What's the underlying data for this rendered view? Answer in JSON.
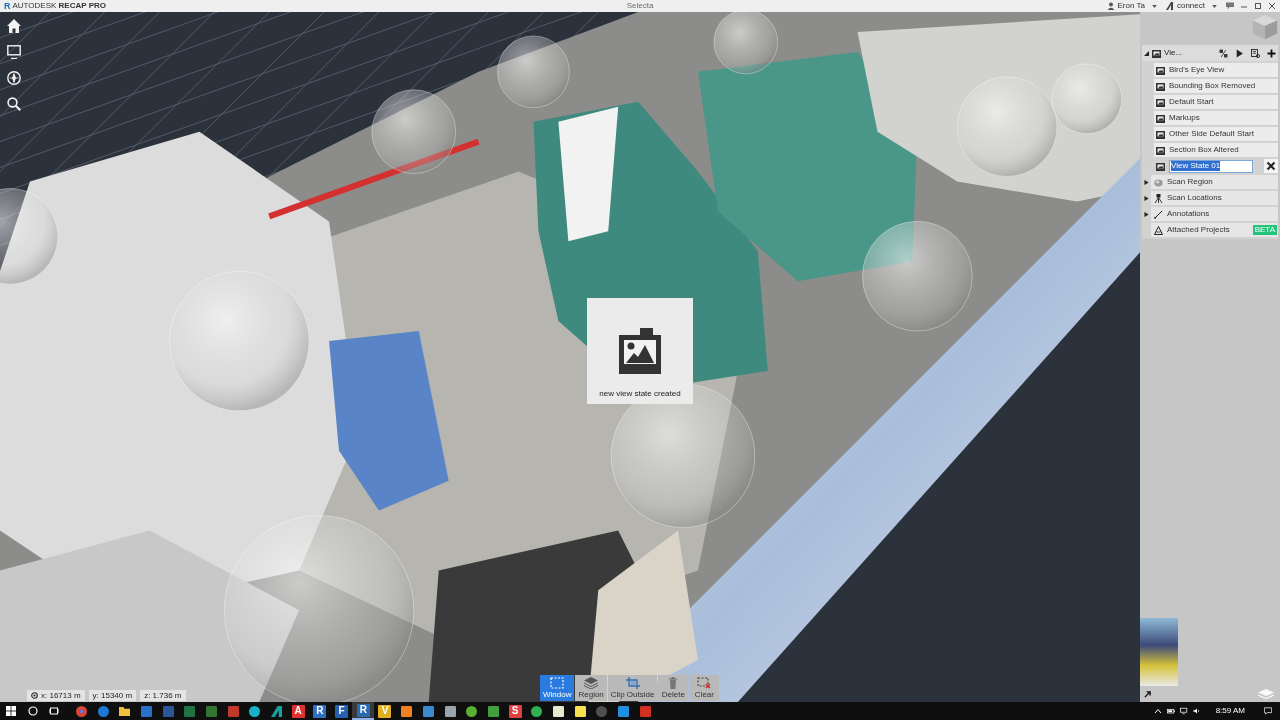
{
  "title_bar": {
    "logo": "R",
    "product": "AUTODESK **RECAP PRO**",
    "document": "Selecta",
    "user": "Eron Ta",
    "service": "connect"
  },
  "viewport": {
    "coordinates": [
      "x: 16713 m",
      "y: 15340 m",
      "z: 1.736 m"
    ]
  },
  "toast": {
    "message": "new view state created"
  },
  "selection_tools": [
    {
      "label": "Window",
      "kind": "window",
      "selected": true
    },
    {
      "label": "Region",
      "kind": "region",
      "selected": false
    },
    {
      "label": "Clip Outside",
      "kind": "clip",
      "selected": false
    },
    {
      "label": "Delete",
      "kind": "delete",
      "selected": false
    },
    {
      "label": "Clear",
      "kind": "clear",
      "selected": false
    }
  ],
  "navigator": {
    "title": "Vie...",
    "expanded": true,
    "view_states": [
      {
        "name": "Bird's Eye View",
        "selected": false
      },
      {
        "name": "Bounding Box Removed",
        "selected": false
      },
      {
        "name": "Default Start",
        "selected": false
      },
      {
        "name": "Markups",
        "selected": false
      },
      {
        "name": "Other Side Default Start",
        "selected": false
      },
      {
        "name": "Section Box Altered",
        "selected": false
      }
    ],
    "new_view_state": {
      "value": "View State 01",
      "text_selected": true
    },
    "sections": [
      {
        "label": "Scan Region",
        "kind": "regions",
        "expanded": false
      },
      {
        "label": "Scan Locations",
        "kind": "locations",
        "expanded": false
      },
      {
        "label": "Annotations",
        "kind": "annotations",
        "expanded": false
      }
    ],
    "attached_projects": {
      "label": "Attached Projects",
      "badge": "BETA"
    }
  },
  "taskbar": {
    "apps": [
      {
        "kind": "browser",
        "color": "#db4437",
        "active": false
      },
      {
        "kind": "round",
        "color": "#1e78d7",
        "active": false
      },
      {
        "kind": "folder",
        "color": "#f0c040",
        "active": false
      },
      {
        "kind": "tile",
        "color": "#2a6fc9",
        "active": false
      },
      {
        "kind": "tile",
        "color": "#2b579a",
        "active": false
      },
      {
        "kind": "tile",
        "color": "#217346",
        "active": false
      },
      {
        "kind": "tile",
        "color": "#31752f",
        "active": false
      },
      {
        "kind": "tile",
        "color": "#c0392b",
        "active": false
      },
      {
        "kind": "round",
        "color": "#1ab0c8",
        "active": false
      },
      {
        "kind": "triangle",
        "color": "#1aa0a0",
        "active": false
      },
      {
        "kind": "letter",
        "letter": "A",
        "color": "#e03030",
        "active": false
      },
      {
        "kind": "letter",
        "letter": "R",
        "color": "#3070c0",
        "active": false
      },
      {
        "kind": "letter",
        "letter": "F",
        "color": "#2860b0",
        "active": false
      },
      {
        "kind": "letter",
        "letter": "R",
        "color": "#2a6bb0",
        "active": true
      },
      {
        "kind": "letter",
        "letter": "V",
        "color": "#e0b020",
        "active": false
      },
      {
        "kind": "tile",
        "color": "#f08020",
        "active": false
      },
      {
        "kind": "tile",
        "color": "#3a8ad0",
        "active": false
      },
      {
        "kind": "tile",
        "color": "#9aa4ae",
        "active": false
      },
      {
        "kind": "round",
        "color": "#5ab030",
        "active": false
      },
      {
        "kind": "tile",
        "color": "#40a040",
        "active": false
      },
      {
        "kind": "letter",
        "letter": "S",
        "color": "#e04040",
        "active": false
      },
      {
        "kind": "round",
        "color": "#30b050",
        "active": false
      },
      {
        "kind": "tile",
        "color": "#e8e8d0",
        "active": false
      },
      {
        "kind": "tile",
        "color": "#f8e050",
        "active": false
      },
      {
        "kind": "round",
        "color": "#505050",
        "active": false
      },
      {
        "kind": "tile",
        "color": "#2090e0",
        "active": false
      },
      {
        "kind": "tile",
        "color": "#d03020",
        "active": false
      }
    ],
    "time": "8:59 AM"
  }
}
